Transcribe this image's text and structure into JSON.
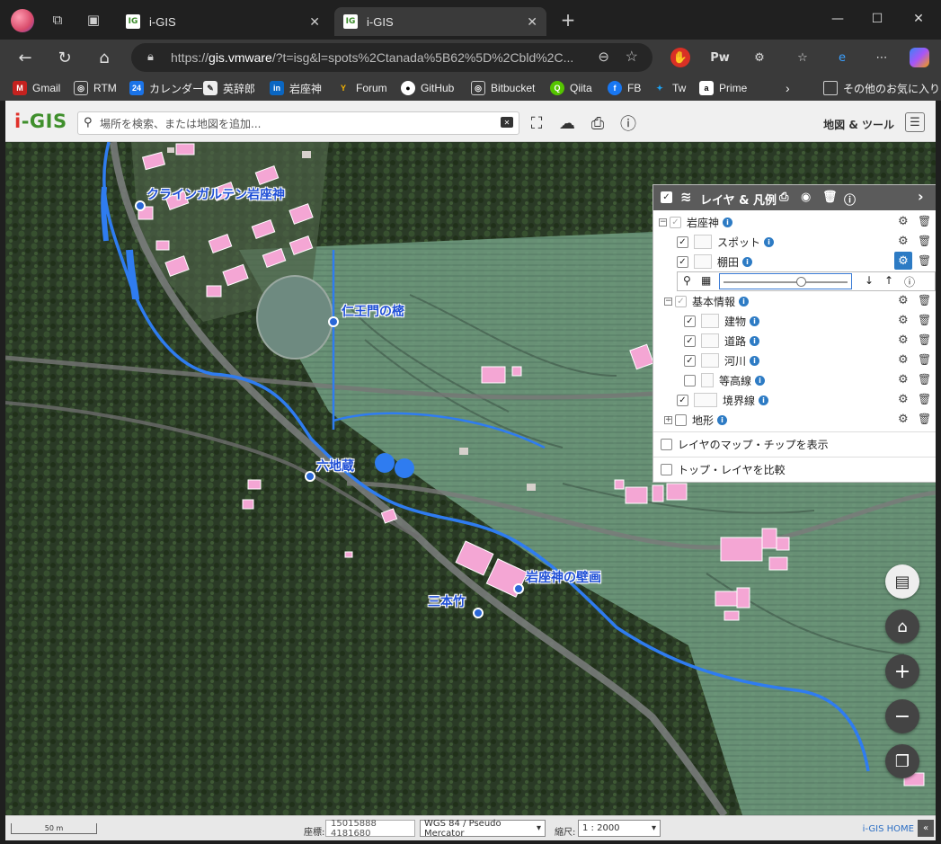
{
  "browser": {
    "tabs": [
      {
        "title": "i-GIS",
        "favicon": "IG"
      },
      {
        "title": "i-GIS",
        "favicon": "IG"
      }
    ],
    "url_prefix": "https://",
    "url_host": "gis.vmware",
    "url_rest": "/?t=isg&l=spots%2Ctanada%5B62%5D%2Cbld%2C...",
    "bookmarks": [
      "Gmail",
      "RTM",
      "カレンダー",
      "英辞郎",
      "岩座神",
      "Forum",
      "GitHub",
      "Bitbucket",
      "Qiita",
      "FB",
      "Tw",
      "Prime"
    ],
    "bookmarks_other": "その他のお気に入り",
    "ext_labels": {
      "pw": "Pw"
    }
  },
  "app": {
    "logo_i": "i",
    "logo_rest": "-GIS",
    "search_placeholder": "場所を検索、または地図を追加...",
    "maptools_label": "地図 & ツール"
  },
  "layers": {
    "title": "レイヤ & 凡例",
    "rows": [
      {
        "label": "岩座神",
        "checked": true
      },
      {
        "label": "スポット",
        "checked": true
      },
      {
        "label": "棚田",
        "checked": true
      },
      {
        "label": "基本情報",
        "checked": true
      },
      {
        "label": "建物",
        "checked": true
      },
      {
        "label": "道路",
        "checked": true
      },
      {
        "label": "河川",
        "checked": true
      },
      {
        "label": "等高線",
        "checked": false
      },
      {
        "label": "境界線",
        "checked": true
      },
      {
        "label": "地形",
        "checked": false
      }
    ],
    "opacity": 0.63,
    "opt_chips": "レイヤのマップ・チップを表示",
    "opt_compare": "トップ・レイヤを比較"
  },
  "pois": [
    {
      "label": "クラインガルテン岩座神"
    },
    {
      "label": "仁王門の樒"
    },
    {
      "label": "六地蔵"
    },
    {
      "label": "岩座神の壁画"
    },
    {
      "label": "三本竹"
    }
  ],
  "status": {
    "scale_label": "50 m",
    "coord_label": "座標:",
    "coord_value": "15015888 4181680",
    "crs": "WGS 84 / Pseudo Mercator",
    "scale_title": "縮尺:",
    "scale_value": "1 : 2000",
    "home_link": "i-GIS HOME",
    "collapse": "«"
  },
  "colors": {
    "river": "#2f7cf0",
    "building": "#f4a6d4",
    "accent_green": "#3f8f2c",
    "poi_blue": "#1f4fd6"
  }
}
